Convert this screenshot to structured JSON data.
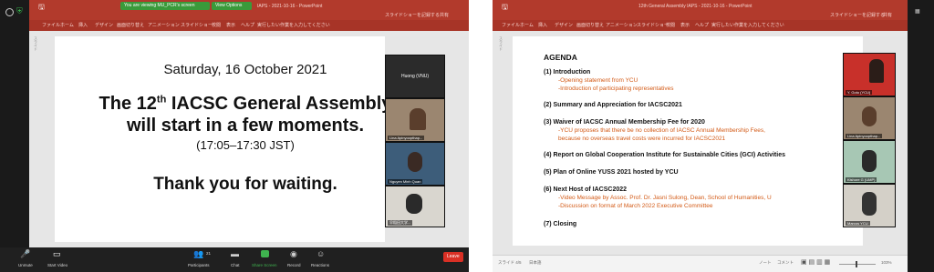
{
  "left": {
    "ribbon": {
      "title": "You are viewing MU_PCR's screen",
      "view_options": "View Options",
      "file_title": "IAPS - 2021-10-16 - PowerPoint",
      "tabs": [
        "ファイル",
        "ホーム",
        "挿入",
        "デザイン",
        "画面切り替え",
        "アニメーション",
        "スライドショー",
        "校閲",
        "表示",
        "ヘルプ",
        "実行したい作業を入力してください"
      ],
      "right_text": "スライドショーを記録する",
      "share": "共有"
    },
    "slide": {
      "date": "Saturday, 16 October 2021",
      "line1_a": "The 12",
      "line1_sup": "th",
      "line1_b": " IACSC General Assembly",
      "line2": "will start in a few moments.",
      "time": "(17:05–17:30 JST)",
      "thanks": "Thank you for waiting."
    },
    "participants": [
      {
        "name": "Huong (VNU)"
      },
      {
        "name": "Lina Apinyoopthap..."
      },
      {
        "name": "Nguyen Minh Quan"
      },
      {
        "name": "早稲田大学..."
      }
    ],
    "zoom": {
      "unmute": "Unmute",
      "start_video": "Start Video",
      "participants": "Participants",
      "participants_count": "21",
      "chat": "Chat",
      "share_screen": "Share Screen",
      "record": "Record",
      "reactions": "Reactions",
      "leave": "Leave"
    }
  },
  "right": {
    "ribbon": {
      "file_title": "12th General Assembly IAPS - 2021-10-16 - PowerPoint",
      "tabs": [
        "ファイル",
        "ホーム",
        "挿入",
        "デザイン",
        "画面切り替え",
        "アニメーション",
        "スライドショー",
        "校閲",
        "表示",
        "ヘルプ",
        "実行したい作業を入力してください"
      ],
      "right_text": "スライドショーを記録する",
      "share": "共有"
    },
    "agenda": {
      "title": "AGENDA",
      "items": [
        {
          "head": "(1) Introduction",
          "subs": [
            "-Opening statement from YCU",
            "-Introduction of participating representatives"
          ]
        },
        {
          "head": "(2) Summary and Appreciation for IACSC2021",
          "subs": []
        },
        {
          "head": "(3) Waiver of IACSC Annual Membership Fee for 2020",
          "subs": [
            "-YCU proposes that there be no collection of IACSC Annual Membership Fees,",
            " because no overseas travel costs were incurred for IACSC2021"
          ]
        },
        {
          "head": "(4) Report on Global Cooperation Institute for Sustainable Cities (GCI) Activities",
          "subs": []
        },
        {
          "head": "(5) Plan of Online YUSS 2021 hosted by YCU",
          "subs": []
        },
        {
          "head": "(6) Next Host of IACSC2022",
          "subs": [
            "-Video Message by Assoc. Prof. Dr. Jasni Sulong, Dean, School of Humanities, U",
            "-Discussion on format of March 2022 Executive Committee"
          ]
        },
        {
          "head": "(7) Closing",
          "subs": []
        }
      ]
    },
    "participants": [
      {
        "name": "Y. Goto (YCU)"
      },
      {
        "name": "Lina Apinyoopthap..."
      },
      {
        "name": "Kishore G (UMP)"
      },
      {
        "name": "Marcos YCU"
      }
    ],
    "status": {
      "slide_info": "スライド 4/5",
      "language": "日本語",
      "notes": "ノート",
      "comments": "コメント",
      "zoom": "103%"
    }
  },
  "colors": {
    "ribbon": "#b23a2c",
    "agenda_sub": "#d35a16",
    "leave": "#d93025",
    "banner_green": "#3a9a3a"
  }
}
